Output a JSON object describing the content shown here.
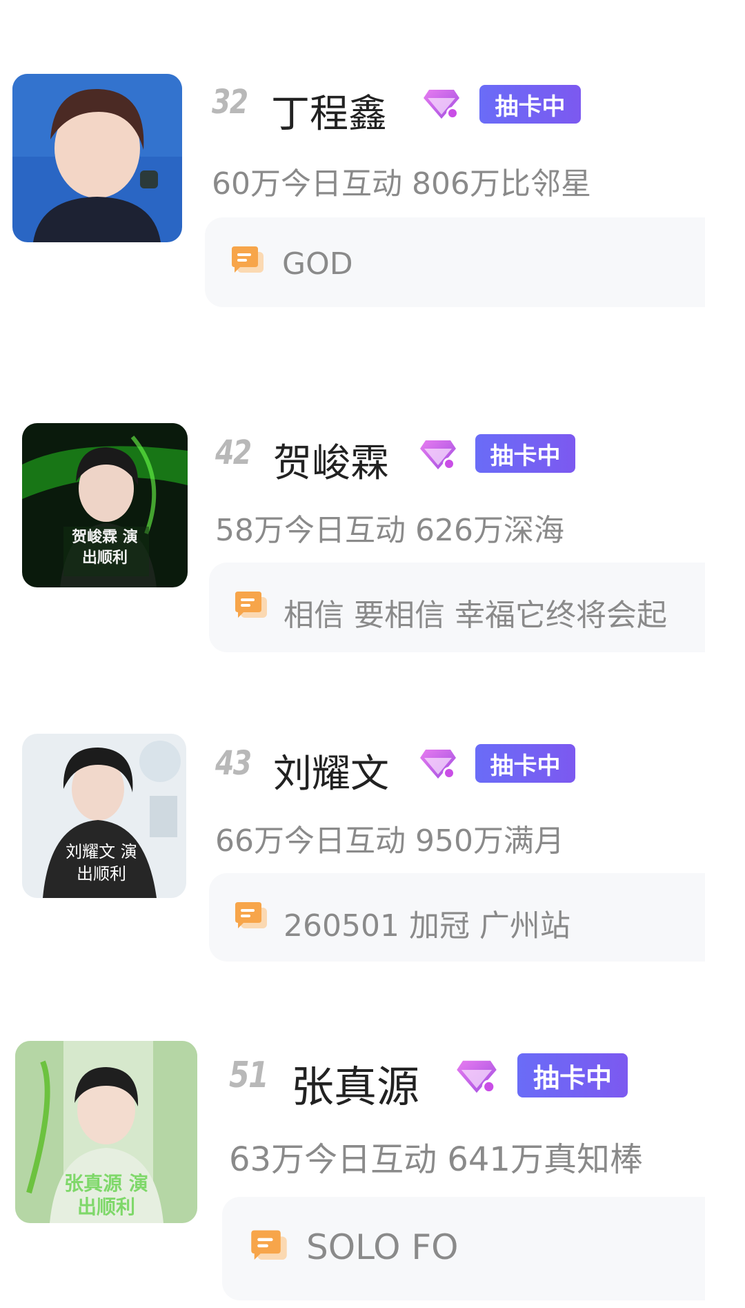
{
  "colors": {
    "badge": "#6f66f3",
    "gem": "#c94ee6",
    "chat_icon": "#f7a54a",
    "rank": "#b8b8b8"
  },
  "items": [
    {
      "rank": "32",
      "name": "丁程鑫",
      "badge": "抽卡中",
      "stats": "60万今日互动 806万比邻星",
      "comment": "GOD",
      "icon": "diamond-icon",
      "avatar_caption": ""
    },
    {
      "rank": "42",
      "name": "贺峻霖",
      "badge": "抽卡中",
      "stats": "58万今日互动 626万深海",
      "comment": "相信 要相信 幸福它终将会起",
      "icon": "diamond-icon",
      "avatar_caption": "贺峻霖 演出顺利"
    },
    {
      "rank": "43",
      "name": "刘耀文",
      "badge": "抽卡中",
      "stats": "66万今日互动 950万满月",
      "comment": "260501 加冠 广州站",
      "icon": "diamond-icon",
      "avatar_caption": "刘耀文 演出顺利"
    },
    {
      "rank": "51",
      "name": "张真源",
      "badge": "抽卡中",
      "stats": "63万今日互动 641万真知棒",
      "comment": "SOLO FO",
      "icon": "diamond-icon",
      "avatar_caption": "张真源 演出顺利"
    }
  ]
}
